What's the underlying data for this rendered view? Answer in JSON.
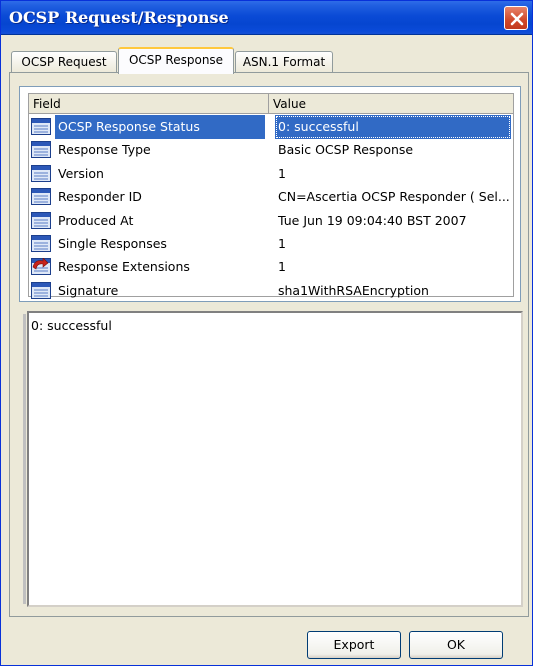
{
  "window": {
    "title": "OCSP Request/Response"
  },
  "tabs": [
    {
      "label": "OCSP Request"
    },
    {
      "label": "OCSP Response"
    },
    {
      "label": "ASN.1 Format"
    }
  ],
  "active_tab": "OCSP Response",
  "table": {
    "columns": [
      {
        "label": "Field"
      },
      {
        "label": "Value"
      }
    ],
    "rows": [
      {
        "field": "OCSP Response Status",
        "value": "0: successful",
        "icon": "field-icon",
        "selected": true
      },
      {
        "field": "Response Type",
        "value": "Basic OCSP Response",
        "icon": "field-icon"
      },
      {
        "field": "Version",
        "value": "1",
        "icon": "field-icon"
      },
      {
        "field": "Responder ID",
        "value": "CN=Ascertia OCSP Responder ( Sel...",
        "icon": "field-icon"
      },
      {
        "field": "Produced At",
        "value": "Tue Jun 19 09:04:40 BST 2007",
        "icon": "field-icon"
      },
      {
        "field": "Single Responses",
        "value": "1",
        "icon": "field-icon"
      },
      {
        "field": "Response Extensions",
        "value": "1",
        "icon": "extension-icon"
      },
      {
        "field": "Signature",
        "value": "sha1WithRSAEncryption",
        "icon": "field-icon"
      }
    ]
  },
  "detail": {
    "text": "0: successful"
  },
  "buttons": {
    "export": "Export",
    "ok": "OK"
  },
  "colors": {
    "title_bar": "#0a4ad6",
    "selection": "#316ac5",
    "active_tab_accent": "#ffc83c"
  }
}
